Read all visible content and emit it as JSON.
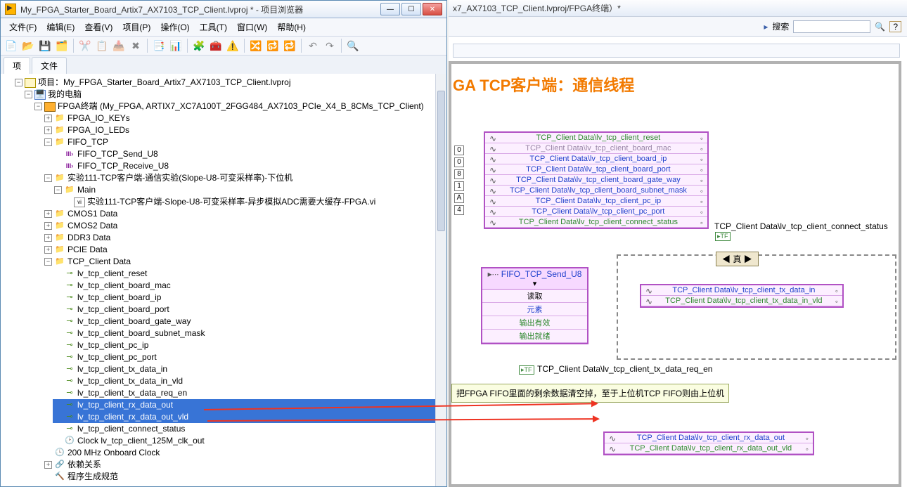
{
  "explorer": {
    "title": "My_FPGA_Starter_Board_Artix7_AX7103_TCP_Client.lvproj * - 项目浏览器",
    "menu": [
      "文件(F)",
      "编辑(E)",
      "查看(V)",
      "项目(P)",
      "操作(O)",
      "工具(T)",
      "窗口(W)",
      "帮助(H)"
    ],
    "tabs": {
      "items": "项",
      "files": "文件"
    },
    "root": "项目：My_FPGA_Starter_Board_Artix7_AX7103_TCP_Client.lvproj",
    "mypc": "我的电脑",
    "fpga_target": "FPGA终端 (My_FPGA, ARTIX7_XC7A100T_2FGG484_AX7103_PCIe_X4_B_8CMs_TCP_Client)",
    "folders": {
      "io_keys": "FPGA_IO_KEYs",
      "io_leds": "FPGA_IO_LEDs",
      "fifo_tcp": "FIFO_TCP",
      "fifo_send": "FIFO_TCP_Send_U8",
      "fifo_recv": "FIFO_TCP_Receive_U8",
      "exp111": "实验111-TCP客户端-通信实验(Slope-U8-可变采样率)-下位机",
      "main": "Main",
      "vi": "实验111-TCP客户端-Slope-U8-可变采样率-异步模拟ADC需要大缓存-FPGA.vi",
      "cmos1": "CMOS1 Data",
      "cmos2": "CMOS2 Data",
      "ddr3": "DDR3 Data",
      "pcie": "PCIE Data",
      "tcp": "TCP_Client Data"
    },
    "signals": [
      "lv_tcp_client_reset",
      "lv_tcp_client_board_mac",
      "lv_tcp_client_board_ip",
      "lv_tcp_client_board_port",
      "lv_tcp_client_board_gate_way",
      "lv_tcp_client_board_subnet_mask",
      "lv_tcp_client_pc_ip",
      "lv_tcp_client_pc_port",
      "lv_tcp_client_tx_data_in",
      "lv_tcp_client_tx_data_in_vld",
      "lv_tcp_client_tx_data_req_en",
      "lv_tcp_client_rx_data_out",
      "lv_tcp_client_rx_data_out_vld",
      "lv_tcp_client_connect_status",
      "Clock lv_tcp_client_125M_clk_out"
    ],
    "onboard_clock": "200 MHz Onboard Clock",
    "deps": "依赖关系",
    "build": "程序生成规范"
  },
  "diagram": {
    "tab_title": "x7_AX7103_TCP_Client.lvproj/FPGA终端）*",
    "search_label": "搜索",
    "heading": "GA TCP客户端：通信线程",
    "bundle_rows": [
      "TCP_Client Data\\lv_tcp_client_reset",
      "TCP_Client Data\\lv_tcp_client_board_mac",
      "TCP_Client Data\\lv_tcp_client_board_ip",
      "TCP_Client Data\\lv_tcp_client_board_port",
      "TCP_Client Data\\lv_tcp_client_board_gate_way",
      "TCP_Client Data\\lv_tcp_client_board_subnet_mask",
      "TCP_Client Data\\lv_tcp_client_pc_ip",
      "TCP_Client Data\\lv_tcp_client_pc_port",
      "TCP_Client Data\\lv_tcp_client_connect_status"
    ],
    "bundle_row_colors": [
      "sig-green",
      "sig-gray",
      "sig-blue",
      "sig-blue",
      "sig-blue",
      "sig-blue",
      "sig-blue",
      "sig-blue",
      "sig-green"
    ],
    "const_nums": [
      "0",
      "0",
      "8",
      "1",
      "A",
      "4"
    ],
    "fifo_block": {
      "title": "FIFO_TCP_Send_U8",
      "rows": [
        "读取",
        "元素",
        "输出有效",
        "输出就绪"
      ]
    },
    "case_label": "◀ 真 ▶",
    "tx_rows": [
      "TCP_Client Data\\lv_tcp_client_tx_data_in",
      "TCP_Client Data\\lv_tcp_client_tx_data_in_vld"
    ],
    "tx_row_colors": [
      "sig-blue",
      "sig-green"
    ],
    "req_en_label": "TCP_Client Data\\lv_tcp_client_tx_data_req_en",
    "connect_status_label": "TCP_Client Data\\lv_tcp_client_connect_status",
    "note": "把FPGA FIFO里面的剩余数据清空掉，至于上位机TCP FIFO则由上位机",
    "rx_rows": [
      "TCP_Client Data\\lv_tcp_client_rx_data_out",
      "TCP_Client Data\\lv_tcp_client_rx_data_out_vld"
    ],
    "rx_row_colors": [
      "sig-blue",
      "sig-green"
    ]
  }
}
